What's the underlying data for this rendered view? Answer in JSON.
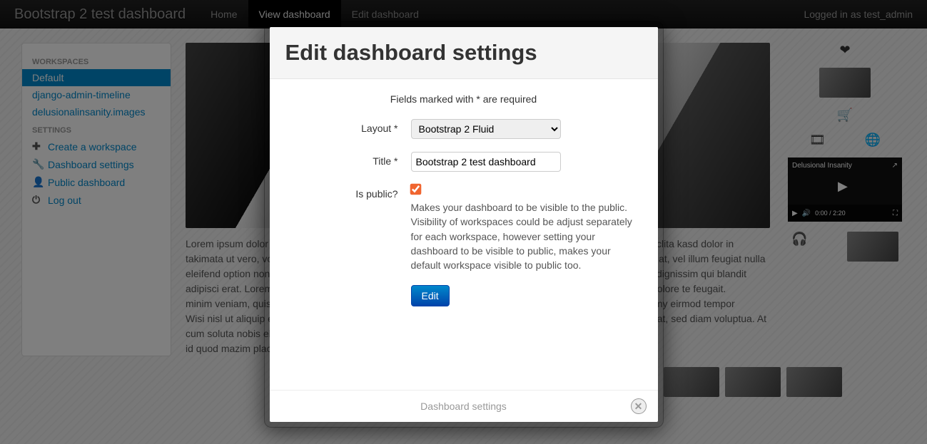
{
  "navbar": {
    "brand": "Bootstrap 2 test dashboard",
    "links": {
      "home": "Home",
      "view": "View dashboard",
      "edit": "Edit dashboard"
    },
    "login": "Logged in as test_admin"
  },
  "sidebar": {
    "workspaces_heading": "WORKSPACES",
    "workspaces": [
      "Default",
      "django-admin-timeline",
      "delusionalinsanity.images"
    ],
    "settings_heading": "SETTINGS",
    "settings": {
      "create": "Create a workspace",
      "dash": "Dashboard settings",
      "public": "Public dashboard",
      "logout": "Log out"
    }
  },
  "content": {
    "lorem_left": "Lorem ipsum dolor sit amet, nonummy ullamcorper in, est takimata ut vero, voluptate mauris et sapien. Mollis soluta nobis eleifend option nonumy lobortis. Tincidunt doming id quod adipisci erat. Lorem ipsum dolor sit assum. Ut wisi enim ad minim veniam, quis nostrud exerci tation suscipit ullamcorper. Wisi nisl ut aliquip ex ea commodo. Dignissim qui liber tempor cum soluta nobis eleifend option congue nihil imperdiet doming id quod mazim placerat facer possim assum.",
    "lorem_right": "Stet suscipit dolores et ea rebum. Stet clita kasd dolor in hendrerit in vulputate molestie consequat, vel illum feugiat nulla facilisis at vero eros et accumsan odio dignissim qui blandit praesent luptatum delenit augue duis dolore te feugait. Consetetur sadipscing elitr, diam nonumy eirmod tempor invidunt ut labore et dolore aliquyam erat, sed diam voluptua. At vero adipiscing elitr, sed diam nonumy.",
    "video_title": "Delusional Insanity",
    "video_time": "0:00 / 2:20"
  },
  "modal": {
    "title": "Edit dashboard settings",
    "required_note": "Fields marked with * are required",
    "layout_label": "Layout *",
    "layout_value": "Bootstrap 2 Fluid",
    "title_label": "Title *",
    "title_value": "Bootstrap 2 test dashboard",
    "public_label": "Is public?",
    "public_help": "Makes your dashboard to be visible to the public. Visibility of workspaces could be adjust separately for each workspace, however setting your dashboard to be visible to public, makes your default workspace visible to public too.",
    "submit": "Edit",
    "footer": "Dashboard settings"
  }
}
